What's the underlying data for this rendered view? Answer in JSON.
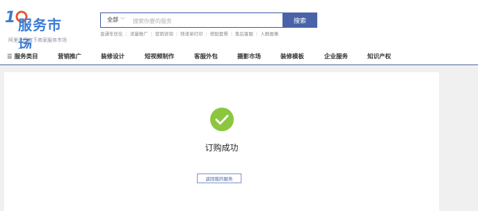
{
  "brand": {
    "logo_text": "服务市场",
    "logo_badge": "10",
    "tagline": "阿里巴巴旗下商家服务市场"
  },
  "search": {
    "scope": "全部",
    "placeholder": "搜索你要的服务",
    "button_label": "搜索"
  },
  "hot_keywords": [
    "直通车优化",
    "流量推广",
    "营销咨询",
    "快递单打印",
    "搭配套餐",
    "售后客服",
    "人群画像"
  ],
  "nav": {
    "items": [
      "☰ 服务类目",
      "营销推广",
      "装修设计",
      "短视频制作",
      "客服外包",
      "摄影市场",
      "装修模板",
      "企业服务",
      "知识产权"
    ]
  },
  "result": {
    "message": "订购成功",
    "return_button": "返回我的服务"
  },
  "colors": {
    "primary": "#4a63a8",
    "success": "#8cc63f",
    "logo_blue": "#3a7bd5"
  }
}
